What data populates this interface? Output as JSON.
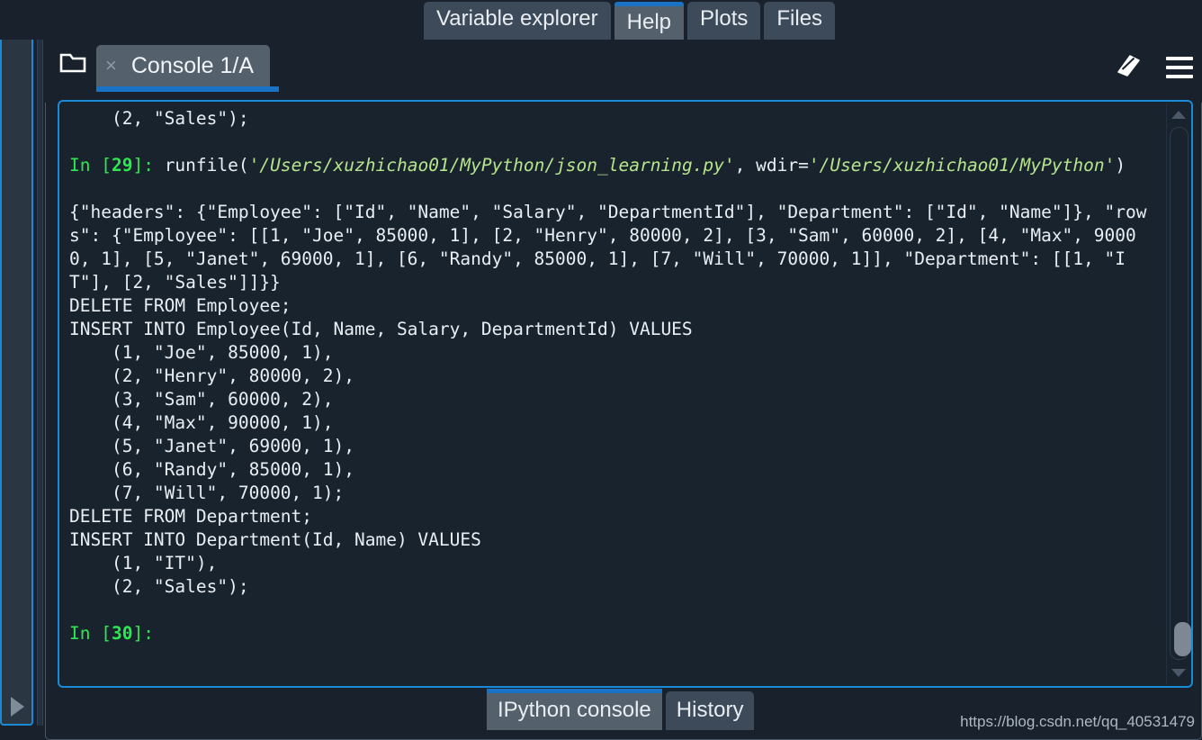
{
  "window": {
    "background_color": "#19222c",
    "accent_color": "#1a72c4",
    "console_background": "#19232d"
  },
  "left_pane": {
    "expand_arrow_icon": "triangle-right-icon"
  },
  "top_tabs": [
    {
      "label": "Variable explorer",
      "active": false
    },
    {
      "label": "Help",
      "active": true
    },
    {
      "label": "Plots",
      "active": false
    },
    {
      "label": "Files",
      "active": false
    }
  ],
  "console_tabbar": {
    "browse_icon": "browse-folder-icon",
    "tab": {
      "label": "Console 1/A",
      "close_label": "×",
      "active": true
    },
    "tools": [
      {
        "name": "stop-button",
        "icon": "stop-square-icon"
      },
      {
        "name": "remove-all-variables-button",
        "icon": "eraser-icon"
      },
      {
        "name": "options-menu-button",
        "icon": "hamburger-menu-icon"
      }
    ]
  },
  "console": {
    "lines": [
      {
        "type": "plain",
        "text": "    (2, \"Sales\");"
      },
      {
        "type": "plain",
        "text": ""
      },
      {
        "type": "prompt",
        "prompt_prefix": "In [",
        "prompt_number": "29",
        "prompt_suffix": "]: ",
        "segments": [
          {
            "style": "code",
            "text": "runfile("
          },
          {
            "style": "string",
            "text": "'/Users/xuzhichao01/MyPython/json_learning.py'"
          },
          {
            "style": "code",
            "text": ", wdir="
          },
          {
            "style": "string",
            "text": "'/Users/xuzhichao01/MyPython'"
          },
          {
            "style": "code",
            "text": ")"
          }
        ]
      },
      {
        "type": "plain",
        "text": ""
      },
      {
        "type": "plain",
        "text": "{\"headers\": {\"Employee\": [\"Id\", \"Name\", \"Salary\", \"DepartmentId\"], \"Department\": [\"Id\", \"Name\"]}, \"rows\": {\"Employee\": [[1, \"Joe\", 85000, 1], [2, \"Henry\", 80000, 2], [3, \"Sam\", 60000, 2], [4, \"Max\", 90000, 1], [5, \"Janet\", 69000, 1], [6, \"Randy\", 85000, 1], [7, \"Will\", 70000, 1]], \"Department\": [[1, \"IT\"], [2, \"Sales\"]]}}"
      },
      {
        "type": "plain",
        "text": "DELETE FROM Employee;"
      },
      {
        "type": "plain",
        "text": "INSERT INTO Employee(Id, Name, Salary, DepartmentId) VALUES"
      },
      {
        "type": "plain",
        "text": "    (1, \"Joe\", 85000, 1),"
      },
      {
        "type": "plain",
        "text": "    (2, \"Henry\", 80000, 2),"
      },
      {
        "type": "plain",
        "text": "    (3, \"Sam\", 60000, 2),"
      },
      {
        "type": "plain",
        "text": "    (4, \"Max\", 90000, 1),"
      },
      {
        "type": "plain",
        "text": "    (5, \"Janet\", 69000, 1),"
      },
      {
        "type": "plain",
        "text": "    (6, \"Randy\", 85000, 1),"
      },
      {
        "type": "plain",
        "text": "    (7, \"Will\", 70000, 1);"
      },
      {
        "type": "plain",
        "text": "DELETE FROM Department;"
      },
      {
        "type": "plain",
        "text": "INSERT INTO Department(Id, Name) VALUES"
      },
      {
        "type": "plain",
        "text": "    (1, \"IT\"),"
      },
      {
        "type": "plain",
        "text": "    (2, \"Sales\");"
      },
      {
        "type": "plain",
        "text": ""
      },
      {
        "type": "prompt",
        "prompt_prefix": "In [",
        "prompt_number": "30",
        "prompt_suffix": "]:",
        "segments": []
      }
    ],
    "scrollbar": {
      "up_arrow_icon": "scroll-up-arrow-icon",
      "down_arrow_icon": "scroll-down-arrow-icon"
    }
  },
  "bottom_tabs": [
    {
      "label": "IPython console",
      "active": true
    },
    {
      "label": "History",
      "active": false
    }
  ],
  "watermark": {
    "text": "https://blog.csdn.net/qq_40531479"
  }
}
